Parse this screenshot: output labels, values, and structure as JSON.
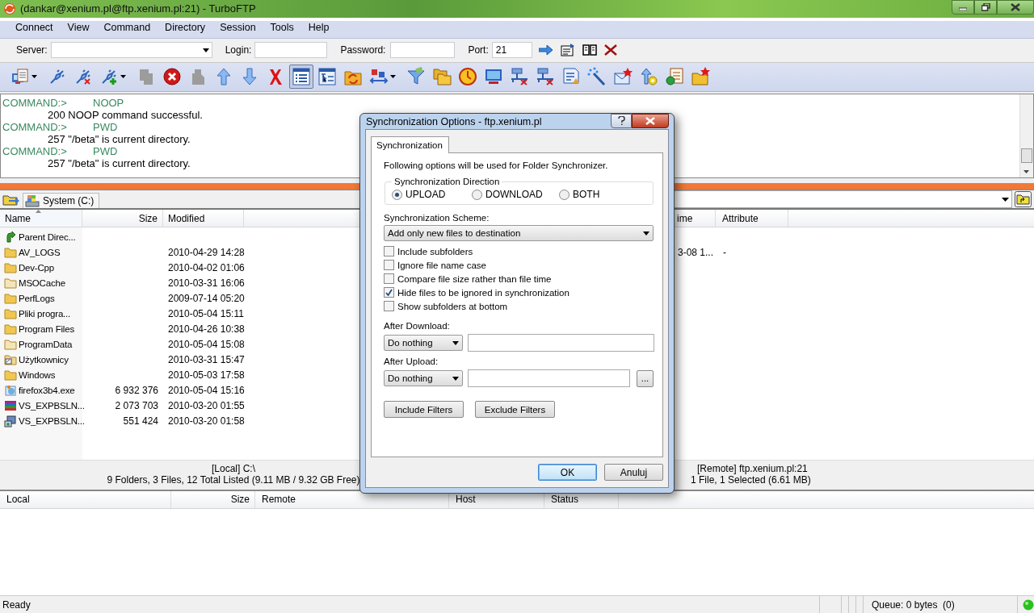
{
  "window": {
    "title": "(dankar@xenium.pl@ftp.xenium.pl:21) - TurboFTP"
  },
  "menu": [
    "Connect",
    "View",
    "Command",
    "Directory",
    "Session",
    "Tools",
    "Help"
  ],
  "connect_bar": {
    "server_label": "Server:",
    "login_label": "Login:",
    "password_label": "Password:",
    "port_label": "Port:",
    "port": "21"
  },
  "toolbar": [
    {
      "kind": "report",
      "pressed": false
    },
    {
      "kind": "plug",
      "pressed": false
    },
    {
      "kind": "unplug",
      "pressed": false
    },
    {
      "kind": "plugadd",
      "pressed": false
    },
    {
      "kind": "copy",
      "pressed": false
    },
    {
      "kind": "stop",
      "pressed": false
    },
    {
      "kind": "paste",
      "pressed": false
    },
    {
      "kind": "up",
      "pressed": false
    },
    {
      "kind": "down",
      "pressed": false
    },
    {
      "kind": "delete",
      "pressed": false
    },
    {
      "kind": "list",
      "pressed": true
    },
    {
      "kind": "tree",
      "pressed": false
    },
    {
      "kind": "sync",
      "pressed": false
    },
    {
      "kind": "rename",
      "pressed": false
    },
    {
      "kind": "filter",
      "pressed": false
    },
    {
      "kind": "folders",
      "pressed": false
    },
    {
      "kind": "clock",
      "pressed": false
    },
    {
      "kind": "monitor",
      "pressed": false
    },
    {
      "kind": "netx",
      "pressed": false
    },
    {
      "kind": "netx",
      "pressed": false
    },
    {
      "kind": "checklist",
      "pressed": false
    },
    {
      "kind": "wand",
      "pressed": false
    },
    {
      "kind": "mail",
      "pressed": false
    },
    {
      "kind": "upgear",
      "pressed": false
    },
    {
      "kind": "schedule",
      "pressed": false
    },
    {
      "kind": "newfolder",
      "pressed": false
    }
  ],
  "log": [
    {
      "kind": "command",
      "label": "COMMAND:>",
      "text": "NOOP"
    },
    {
      "kind": "response",
      "text": "200 NOOP command successful."
    },
    {
      "kind": "command",
      "label": "COMMAND:>",
      "text": "PWD"
    },
    {
      "kind": "response",
      "text": "257 \"/beta\" is current directory."
    },
    {
      "kind": "command",
      "label": "COMMAND:>",
      "text": "PWD"
    },
    {
      "kind": "response",
      "text": "257 \"/beta\" is current directory."
    }
  ],
  "local": {
    "drive": "System (C:)",
    "columns": [
      "Name",
      "Size",
      "Modified"
    ],
    "rows": [
      {
        "kind": "parent",
        "name": "Parent Direc..."
      },
      {
        "kind": "folder",
        "name": "AV_LOGS",
        "modified": "2010-04-29 14:28"
      },
      {
        "kind": "folder",
        "name": "Dev-Cpp",
        "modified": "2010-04-02 01:06"
      },
      {
        "kind": "hidden",
        "name": "MSOCache",
        "modified": "2010-03-31 16:06"
      },
      {
        "kind": "folder",
        "name": "PerfLogs",
        "modified": "2009-07-14 05:20"
      },
      {
        "kind": "folder",
        "name": "Pliki progra...",
        "modified": "2010-05-04 15:11"
      },
      {
        "kind": "folder",
        "name": "Program Files",
        "modified": "2010-04-26 10:38"
      },
      {
        "kind": "hidden",
        "name": "ProgramData",
        "modified": "2010-05-04 15:08"
      },
      {
        "kind": "link",
        "name": "Użytkownicy",
        "modified": "2010-03-31 15:47"
      },
      {
        "kind": "folder",
        "name": "Windows",
        "modified": "2010-05-03 17:58"
      },
      {
        "kind": "exe",
        "name": "firefox3b4.exe",
        "size": "6 932 376",
        "modified": "2010-05-04 15:16"
      },
      {
        "kind": "archive",
        "name": "VS_EXPBSLN...",
        "size": "2 073 703",
        "modified": "2010-03-20 01:55"
      },
      {
        "kind": "installer",
        "name": "VS_EXPBSLN...",
        "size": "551 424",
        "modified": "2010-03-20 01:58"
      }
    ],
    "status": [
      "[Local] C:\\",
      "9 Folders, 3 Files, 12 Total Listed (9.11 MB / 9.32 GB Free)"
    ]
  },
  "remote": {
    "columns": [
      "ime",
      "Attribute"
    ],
    "rows": [
      [
        "3-08 1...",
        "-"
      ]
    ],
    "status": [
      "[Remote] ftp.xenium.pl:21",
      "1 File, 1 Selected (6.61 MB)"
    ]
  },
  "queue": {
    "columns": [
      "Local",
      "Size",
      "Remote",
      "Host",
      "Status"
    ]
  },
  "status_bar": {
    "left": "Ready",
    "queue": "Queue: 0 bytes  (0)"
  },
  "dialog": {
    "title": "Synchronization Options - ftp.xenium.pl",
    "tabs": [
      {
        "label": "Synchronization",
        "selected": true
      }
    ],
    "intro": "Following options will be used for Folder Synchronizer.",
    "direction": {
      "legend": "Synchronization Direction",
      "options": [
        {
          "label": "UPLOAD",
          "selected": true
        },
        {
          "label": "DOWNLOAD",
          "selected": false
        },
        {
          "label": "BOTH",
          "selected": false
        }
      ]
    },
    "scheme": {
      "label": "Synchronization Scheme:",
      "value": "Add only new files to destination"
    },
    "options": [
      {
        "label": "Include subfolders",
        "checked": false
      },
      {
        "label": "Ignore file name case",
        "checked": false
      },
      {
        "label": "Compare file size rather than file time",
        "checked": false
      },
      {
        "label": "Hide files to be ignored in synchronization",
        "checked": true
      },
      {
        "label": "Show subfolders at bottom",
        "checked": false
      }
    ],
    "after_download": {
      "label": "After Download:",
      "action": "Do nothing"
    },
    "after_upload": {
      "label": "After Upload:",
      "action": "Do nothing",
      "browse": "..."
    },
    "filter_buttons": [
      "Include Filters",
      "Exclude Filters"
    ],
    "buttons": [
      {
        "label": "OK",
        "default": true
      },
      {
        "label": "Anuluj",
        "default": false
      }
    ]
  }
}
